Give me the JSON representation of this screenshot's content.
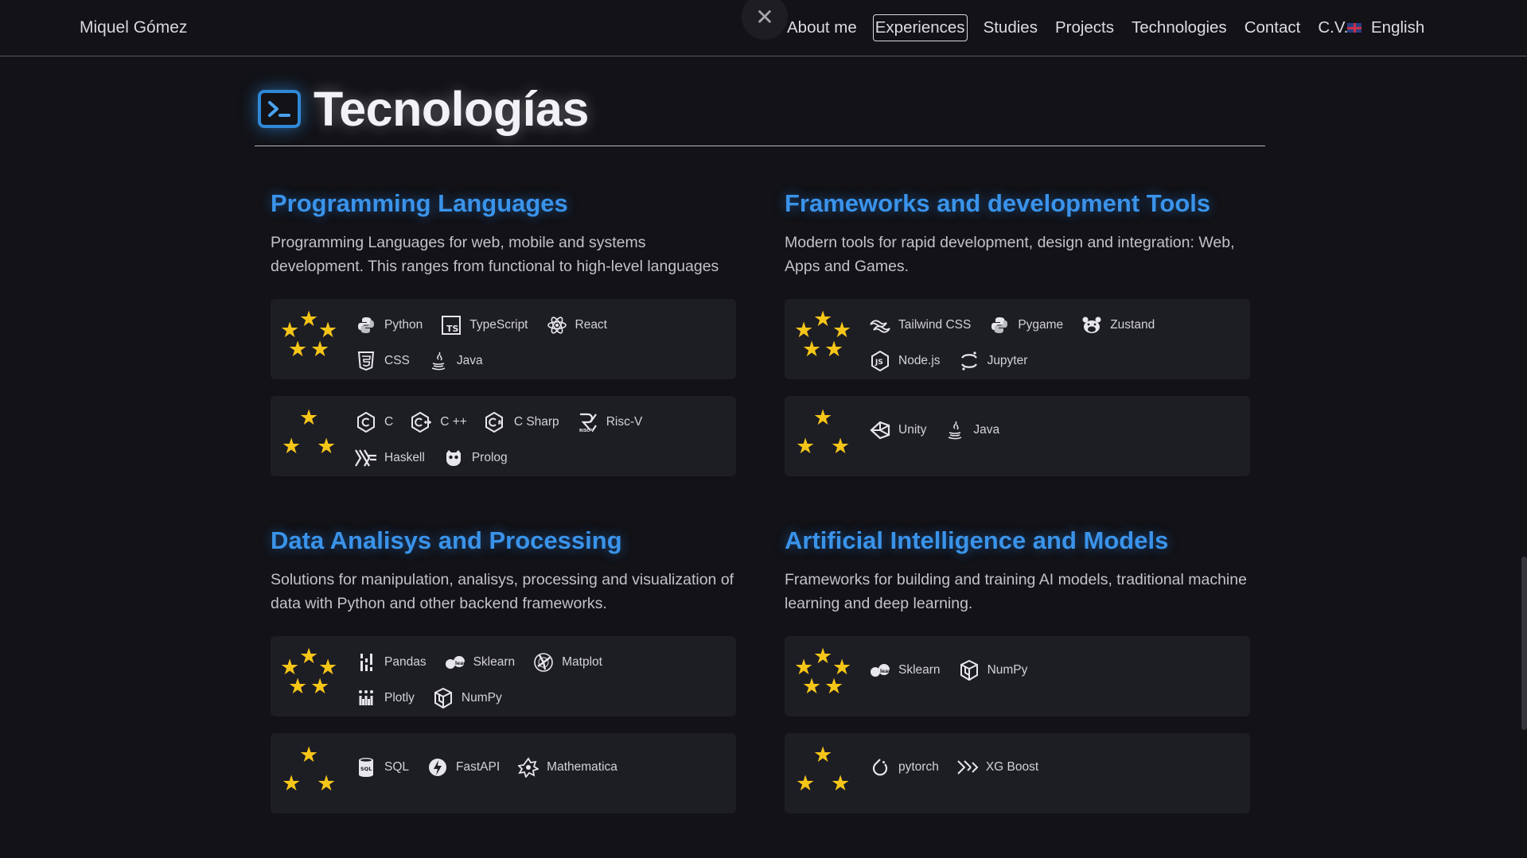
{
  "nav": {
    "brand": "Miquel Gómez",
    "close_glyph": "✕",
    "items": [
      {
        "label": "About me",
        "active": false
      },
      {
        "label": "Experiences",
        "active": true
      },
      {
        "label": "Studies",
        "active": false
      },
      {
        "label": "Projects",
        "active": false
      },
      {
        "label": "Technologies",
        "active": false
      },
      {
        "label": "Contact",
        "active": false
      },
      {
        "label": "C.V.",
        "active": false
      }
    ],
    "language": "English",
    "language_flag_icon": "uk-flag-icon"
  },
  "section": {
    "title": "Tecnologías",
    "icon": "terminal-icon"
  },
  "categories": [
    {
      "title": "Programming Languages",
      "description": "Programming Languages for web, mobile and systems development. This ranges from functional to high-level languages",
      "tiers": [
        {
          "stars": 5,
          "items": [
            {
              "label": "Python",
              "icon": "python-icon"
            },
            {
              "label": "TypeScript",
              "icon": "typescript-icon"
            },
            {
              "label": "React",
              "icon": "react-icon"
            },
            {
              "label": "CSS",
              "icon": "css-icon"
            },
            {
              "label": "Java",
              "icon": "java-icon"
            }
          ]
        },
        {
          "stars": 3,
          "items": [
            {
              "label": "C",
              "icon": "c-icon"
            },
            {
              "label": "C ++",
              "icon": "cpp-icon"
            },
            {
              "label": "C Sharp",
              "icon": "csharp-icon"
            },
            {
              "label": "Risc-V",
              "icon": "riscv-icon"
            },
            {
              "label": "Haskell",
              "icon": "haskell-icon"
            },
            {
              "label": "Prolog",
              "icon": "prolog-icon"
            }
          ]
        }
      ]
    },
    {
      "title": "Frameworks and development Tools",
      "description": "Modern tools for rapid development, design and integration: Web, Apps and Games.",
      "tiers": [
        {
          "stars": 5,
          "items": [
            {
              "label": "Tailwind CSS",
              "icon": "tailwind-icon"
            },
            {
              "label": "Pygame",
              "icon": "pygame-icon"
            },
            {
              "label": "Zustand",
              "icon": "zustand-icon"
            },
            {
              "label": "Node.js",
              "icon": "nodejs-icon"
            },
            {
              "label": "Jupyter",
              "icon": "jupyter-icon"
            }
          ]
        },
        {
          "stars": 3,
          "items": [
            {
              "label": "Unity",
              "icon": "unity-icon"
            },
            {
              "label": "Java",
              "icon": "java-icon"
            }
          ]
        }
      ]
    },
    {
      "title": "Data Analisys and Processing",
      "description": "Solutions for manipulation, analisys, processing and visualization of data with Python and other backend frameworks.",
      "tiers": [
        {
          "stars": 5,
          "items": [
            {
              "label": "Pandas",
              "icon": "pandas-icon"
            },
            {
              "label": "Sklearn",
              "icon": "sklearn-icon"
            },
            {
              "label": "Matplot",
              "icon": "matplotlib-icon"
            },
            {
              "label": "Plotly",
              "icon": "plotly-icon"
            },
            {
              "label": "NumPy",
              "icon": "numpy-icon"
            }
          ]
        },
        {
          "stars": 3,
          "items": [
            {
              "label": "SQL",
              "icon": "sql-icon"
            },
            {
              "label": "FastAPI",
              "icon": "fastapi-icon"
            },
            {
              "label": "Mathematica",
              "icon": "mathematica-icon"
            }
          ]
        }
      ]
    },
    {
      "title": "Artificial Intelligence and Models",
      "description": "Frameworks for building and training AI models, traditional machine learning and deep learning.",
      "tiers": [
        {
          "stars": 5,
          "items": [
            {
              "label": "Sklearn",
              "icon": "sklearn-icon"
            },
            {
              "label": "NumPy",
              "icon": "numpy-icon"
            }
          ]
        },
        {
          "stars": 3,
          "items": [
            {
              "label": "pytorch",
              "icon": "pytorch-icon"
            },
            {
              "label": "XG Boost",
              "icon": "xgboost-icon"
            }
          ]
        }
      ]
    }
  ],
  "colors": {
    "background": "#121217",
    "card": "#1d1d24",
    "accent": "#3a93ea",
    "star": "#f5c518"
  }
}
